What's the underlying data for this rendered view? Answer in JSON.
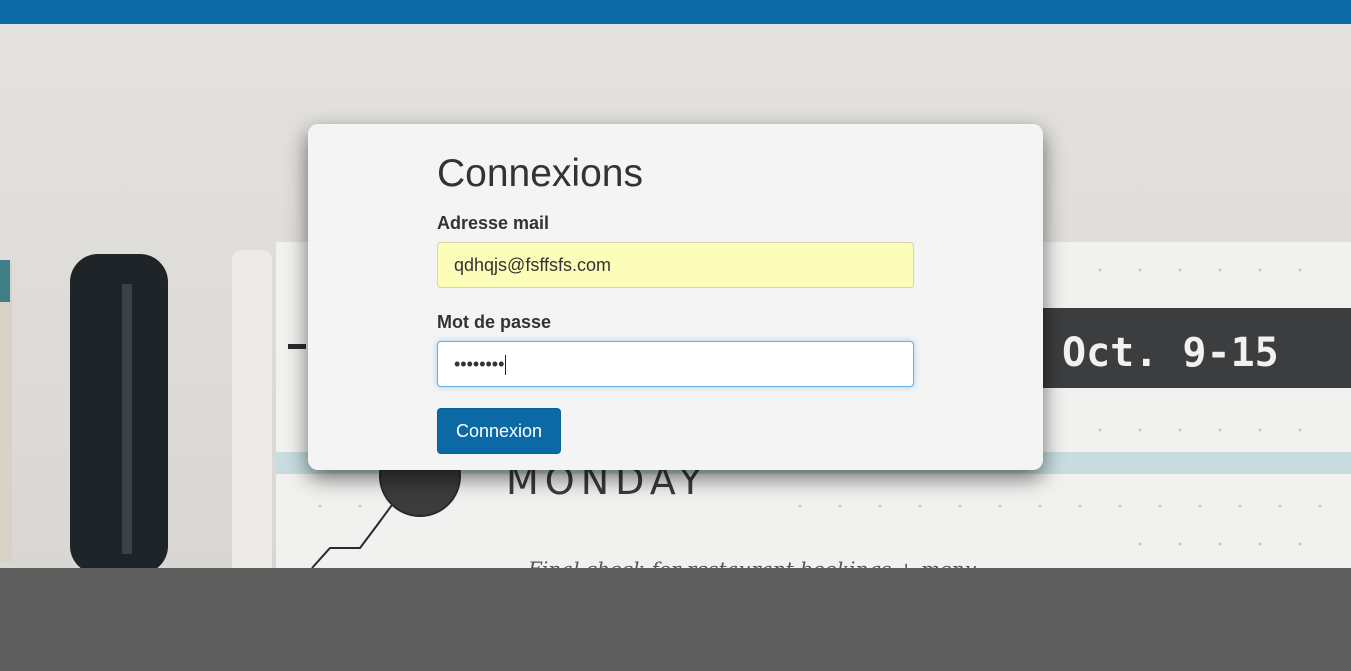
{
  "colors": {
    "brand": "#0b6aa6",
    "footer": "#5f5f5f",
    "card_bg": "#f4f4f4",
    "autofill_bg": "#fcfdb8",
    "focus_border": "#66afe9"
  },
  "login": {
    "title": "Connexions",
    "email_label": "Adresse mail",
    "email_value": "qdhqjs@fsffsfs.com",
    "password_label": "Mot de passe",
    "password_masked": "••••••••",
    "submit_label": "Connexion"
  },
  "background": {
    "photo_text": "Oct. 9-15",
    "day_text": "MONDAY",
    "note_text": "Final check for restaurant bookings + menu"
  }
}
